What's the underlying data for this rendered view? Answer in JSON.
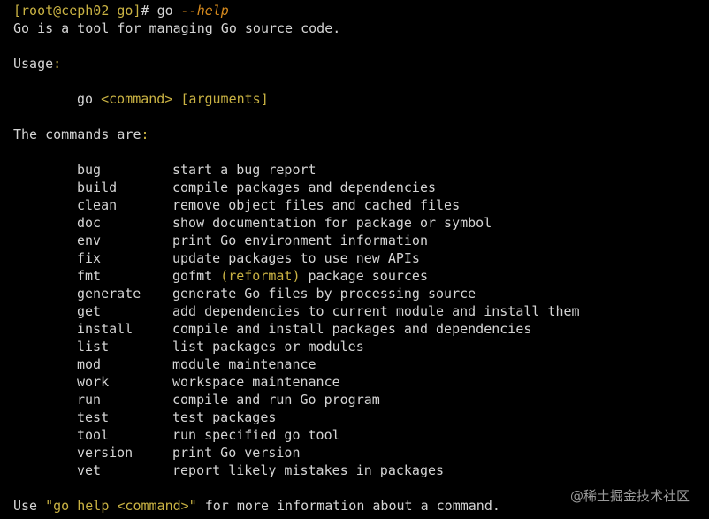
{
  "prompt": {
    "user_host": "[root@ceph02 go]",
    "symbol": "# ",
    "command": "go",
    "flag": "--help"
  },
  "intro": "Go is a tool for managing Go source code.",
  "usage": {
    "label": "Usage",
    "colon": ":",
    "go": "go",
    "command_placeholder": "<command>",
    "args_placeholder": "[arguments]"
  },
  "commands_heading": {
    "text": "The commands are",
    "colon": ":"
  },
  "commands": [
    {
      "name": "bug",
      "description": "start a bug report"
    },
    {
      "name": "build",
      "description": "compile packages and dependencies"
    },
    {
      "name": "clean",
      "description": "remove object files and cached files"
    },
    {
      "name": "doc",
      "description": "show documentation for package or symbol"
    },
    {
      "name": "env",
      "description": "print Go environment information"
    },
    {
      "name": "fix",
      "description": "update packages to use new APIs"
    },
    {
      "name": "fmt",
      "description": "gofmt (reformat) package sources"
    },
    {
      "name": "generate",
      "description": "generate Go files by processing source"
    },
    {
      "name": "get",
      "description": "add dependencies to current module and install them"
    },
    {
      "name": "install",
      "description": "compile and install packages and dependencies"
    },
    {
      "name": "list",
      "description": "list packages or modules"
    },
    {
      "name": "mod",
      "description": "module maintenance"
    },
    {
      "name": "work",
      "description": "workspace maintenance"
    },
    {
      "name": "run",
      "description": "compile and run Go program"
    },
    {
      "name": "test",
      "description": "test packages"
    },
    {
      "name": "tool",
      "description": "run specified go tool"
    },
    {
      "name": "version",
      "description": "print Go version"
    },
    {
      "name": "vet",
      "description": "report likely mistakes in packages"
    }
  ],
  "footer": {
    "prefix": "Use ",
    "quoted": "\"go help <command>\"",
    "suffix": " for more information about a command."
  },
  "watermark": "@稀土掘金技术社区",
  "colors": {
    "background": "#000000",
    "text": "#d4d4d4",
    "yellow": "#c9b243",
    "flag": "#d68a1d"
  }
}
